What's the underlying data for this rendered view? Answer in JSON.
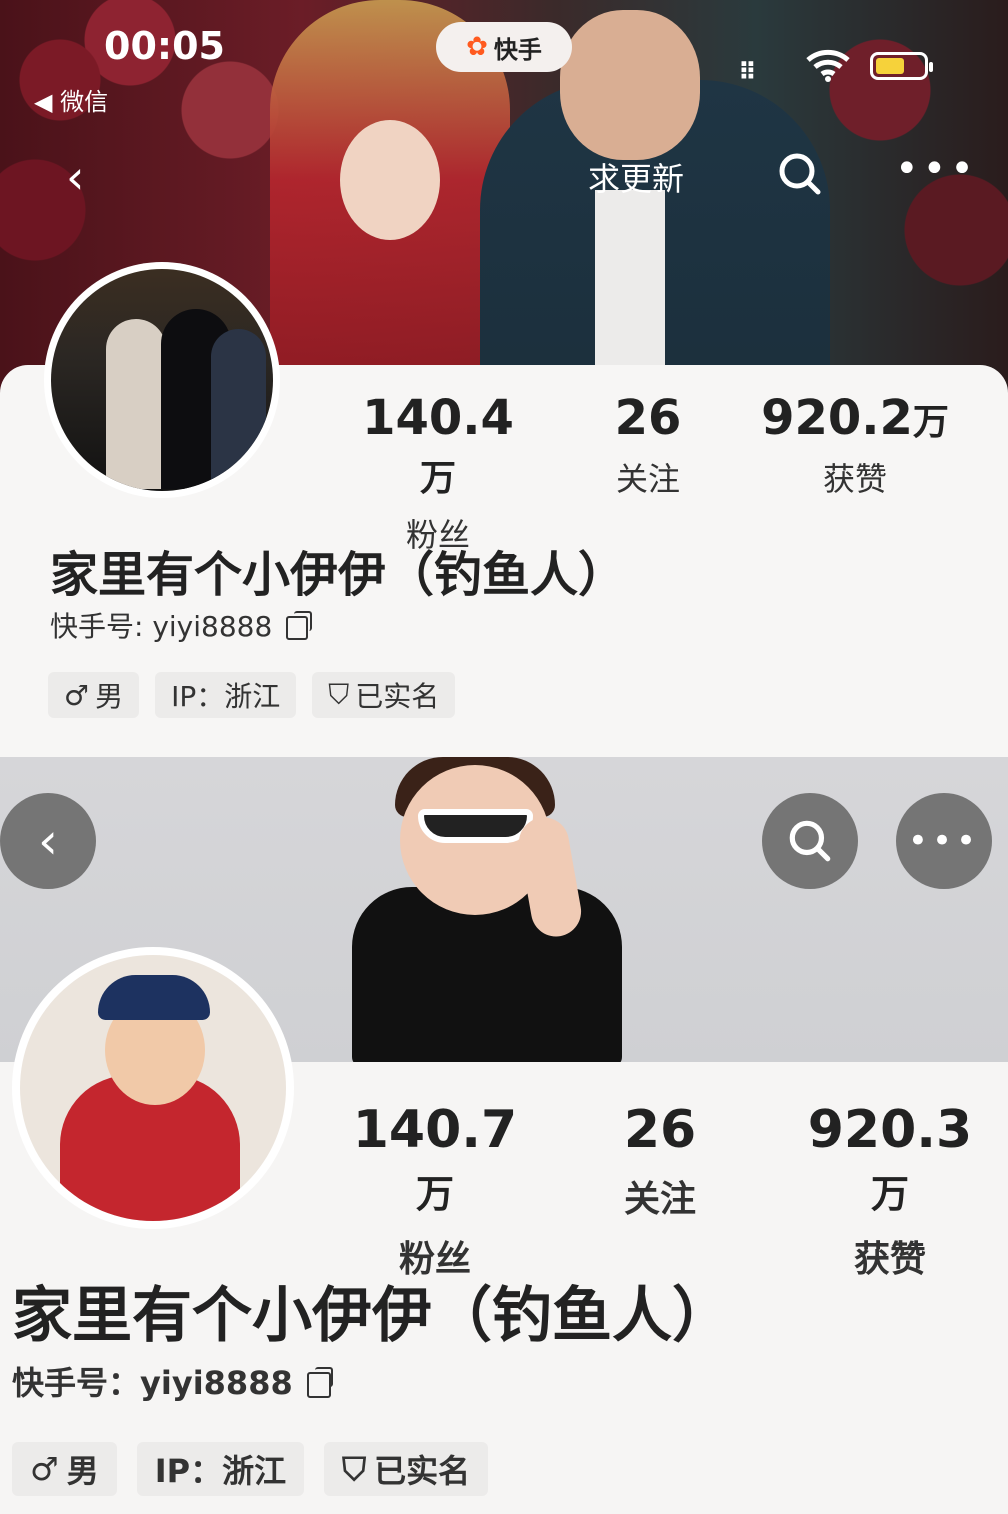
{
  "status_bar": {
    "time": "00:05",
    "back_app": "◀ 微信",
    "app_name": "快手",
    "signal_text": "⠿"
  },
  "panel1": {
    "nav": {
      "back": "‹",
      "request_update": "求更新",
      "more": "•••"
    },
    "stats": [
      {
        "value": "140.4",
        "unit": "万",
        "label": "粉丝"
      },
      {
        "value": "26",
        "unit": "",
        "label": "关注"
      },
      {
        "value": "920.2",
        "unit": "万",
        "label": "获赞"
      }
    ],
    "name": "家里有个小伊伊（钓鱼人）",
    "kuaishou_id": "快手号: yiyi8888",
    "tags": [
      {
        "icon": "♂",
        "text": "男"
      },
      {
        "icon": "",
        "text": "IP：浙江"
      },
      {
        "icon": "⛉",
        "text": "已实名"
      }
    ]
  },
  "panel2": {
    "nav": {
      "back": "‹",
      "more": "•••"
    },
    "stats": [
      {
        "value": "140.7",
        "unit": "万",
        "label": "粉丝"
      },
      {
        "value": "26",
        "unit": "",
        "label": "关注"
      },
      {
        "value": "920.3",
        "unit": "万",
        "label": "获赞"
      }
    ],
    "name": "家里有个小伊伊（钓鱼人）",
    "kuaishou_id": "快手号：yiyi8888",
    "tags": [
      {
        "icon": "♂",
        "text": "男"
      },
      {
        "icon": "",
        "text": "IP：浙江"
      },
      {
        "icon": "⛉",
        "text": "已实名"
      }
    ]
  },
  "colors": {
    "brand_logo": "#ff5a1f",
    "battery": "#f6d23a",
    "tag_bg": "#ecebea"
  }
}
